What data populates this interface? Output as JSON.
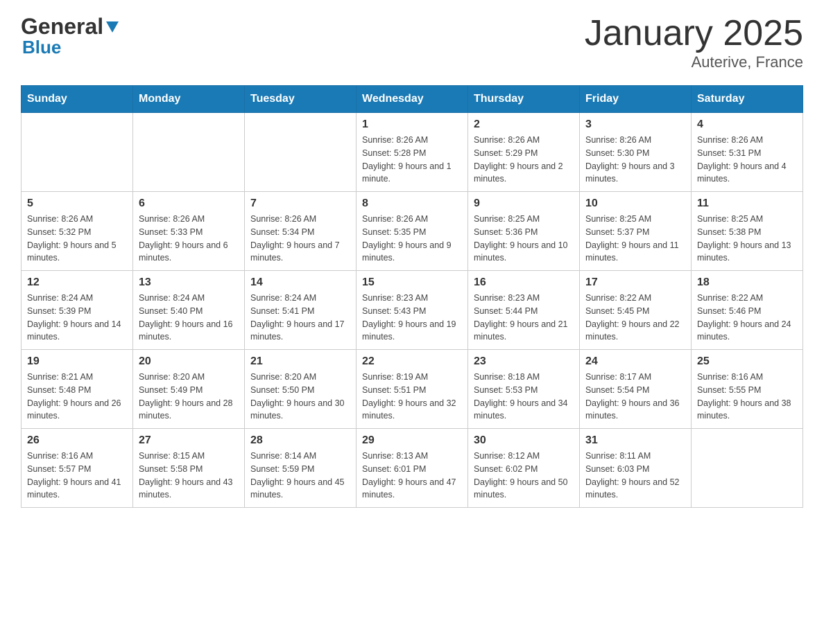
{
  "logo": {
    "general": "General",
    "blue": "Blue"
  },
  "title": "January 2025",
  "subtitle": "Auterive, France",
  "weekdays": [
    "Sunday",
    "Monday",
    "Tuesday",
    "Wednesday",
    "Thursday",
    "Friday",
    "Saturday"
  ],
  "weeks": [
    [
      {
        "day": "",
        "info": ""
      },
      {
        "day": "",
        "info": ""
      },
      {
        "day": "",
        "info": ""
      },
      {
        "day": "1",
        "info": "Sunrise: 8:26 AM\nSunset: 5:28 PM\nDaylight: 9 hours and 1 minute."
      },
      {
        "day": "2",
        "info": "Sunrise: 8:26 AM\nSunset: 5:29 PM\nDaylight: 9 hours and 2 minutes."
      },
      {
        "day": "3",
        "info": "Sunrise: 8:26 AM\nSunset: 5:30 PM\nDaylight: 9 hours and 3 minutes."
      },
      {
        "day": "4",
        "info": "Sunrise: 8:26 AM\nSunset: 5:31 PM\nDaylight: 9 hours and 4 minutes."
      }
    ],
    [
      {
        "day": "5",
        "info": "Sunrise: 8:26 AM\nSunset: 5:32 PM\nDaylight: 9 hours and 5 minutes."
      },
      {
        "day": "6",
        "info": "Sunrise: 8:26 AM\nSunset: 5:33 PM\nDaylight: 9 hours and 6 minutes."
      },
      {
        "day": "7",
        "info": "Sunrise: 8:26 AM\nSunset: 5:34 PM\nDaylight: 9 hours and 7 minutes."
      },
      {
        "day": "8",
        "info": "Sunrise: 8:26 AM\nSunset: 5:35 PM\nDaylight: 9 hours and 9 minutes."
      },
      {
        "day": "9",
        "info": "Sunrise: 8:25 AM\nSunset: 5:36 PM\nDaylight: 9 hours and 10 minutes."
      },
      {
        "day": "10",
        "info": "Sunrise: 8:25 AM\nSunset: 5:37 PM\nDaylight: 9 hours and 11 minutes."
      },
      {
        "day": "11",
        "info": "Sunrise: 8:25 AM\nSunset: 5:38 PM\nDaylight: 9 hours and 13 minutes."
      }
    ],
    [
      {
        "day": "12",
        "info": "Sunrise: 8:24 AM\nSunset: 5:39 PM\nDaylight: 9 hours and 14 minutes."
      },
      {
        "day": "13",
        "info": "Sunrise: 8:24 AM\nSunset: 5:40 PM\nDaylight: 9 hours and 16 minutes."
      },
      {
        "day": "14",
        "info": "Sunrise: 8:24 AM\nSunset: 5:41 PM\nDaylight: 9 hours and 17 minutes."
      },
      {
        "day": "15",
        "info": "Sunrise: 8:23 AM\nSunset: 5:43 PM\nDaylight: 9 hours and 19 minutes."
      },
      {
        "day": "16",
        "info": "Sunrise: 8:23 AM\nSunset: 5:44 PM\nDaylight: 9 hours and 21 minutes."
      },
      {
        "day": "17",
        "info": "Sunrise: 8:22 AM\nSunset: 5:45 PM\nDaylight: 9 hours and 22 minutes."
      },
      {
        "day": "18",
        "info": "Sunrise: 8:22 AM\nSunset: 5:46 PM\nDaylight: 9 hours and 24 minutes."
      }
    ],
    [
      {
        "day": "19",
        "info": "Sunrise: 8:21 AM\nSunset: 5:48 PM\nDaylight: 9 hours and 26 minutes."
      },
      {
        "day": "20",
        "info": "Sunrise: 8:20 AM\nSunset: 5:49 PM\nDaylight: 9 hours and 28 minutes."
      },
      {
        "day": "21",
        "info": "Sunrise: 8:20 AM\nSunset: 5:50 PM\nDaylight: 9 hours and 30 minutes."
      },
      {
        "day": "22",
        "info": "Sunrise: 8:19 AM\nSunset: 5:51 PM\nDaylight: 9 hours and 32 minutes."
      },
      {
        "day": "23",
        "info": "Sunrise: 8:18 AM\nSunset: 5:53 PM\nDaylight: 9 hours and 34 minutes."
      },
      {
        "day": "24",
        "info": "Sunrise: 8:17 AM\nSunset: 5:54 PM\nDaylight: 9 hours and 36 minutes."
      },
      {
        "day": "25",
        "info": "Sunrise: 8:16 AM\nSunset: 5:55 PM\nDaylight: 9 hours and 38 minutes."
      }
    ],
    [
      {
        "day": "26",
        "info": "Sunrise: 8:16 AM\nSunset: 5:57 PM\nDaylight: 9 hours and 41 minutes."
      },
      {
        "day": "27",
        "info": "Sunrise: 8:15 AM\nSunset: 5:58 PM\nDaylight: 9 hours and 43 minutes."
      },
      {
        "day": "28",
        "info": "Sunrise: 8:14 AM\nSunset: 5:59 PM\nDaylight: 9 hours and 45 minutes."
      },
      {
        "day": "29",
        "info": "Sunrise: 8:13 AM\nSunset: 6:01 PM\nDaylight: 9 hours and 47 minutes."
      },
      {
        "day": "30",
        "info": "Sunrise: 8:12 AM\nSunset: 6:02 PM\nDaylight: 9 hours and 50 minutes."
      },
      {
        "day": "31",
        "info": "Sunrise: 8:11 AM\nSunset: 6:03 PM\nDaylight: 9 hours and 52 minutes."
      },
      {
        "day": "",
        "info": ""
      }
    ]
  ]
}
